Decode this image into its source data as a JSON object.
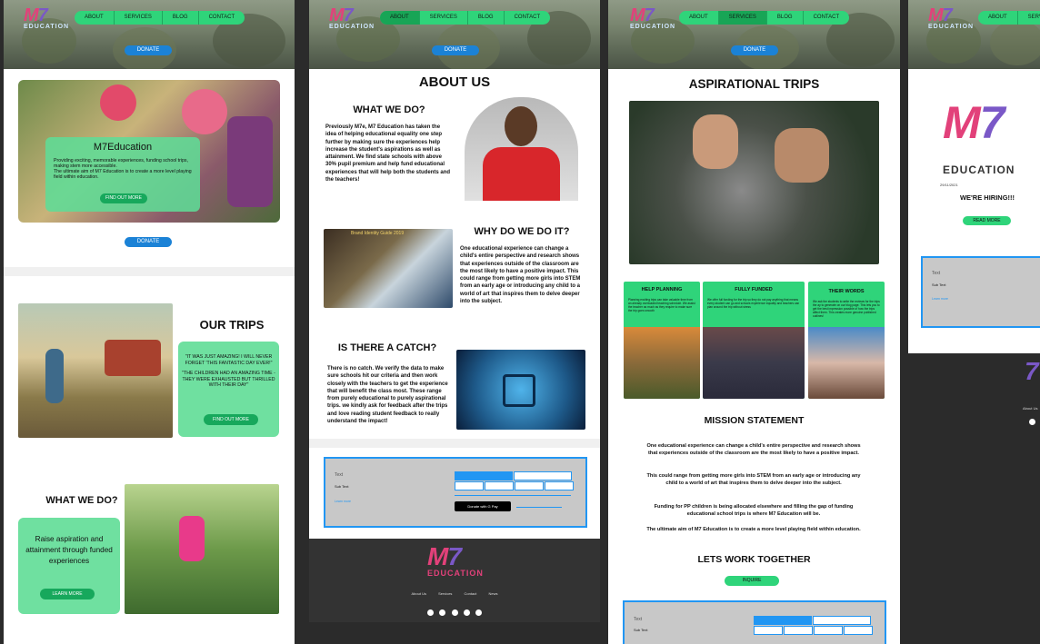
{
  "nav": {
    "about": "ABOUT",
    "services": "SERVICES",
    "blog": "BLOG",
    "contact": "CONTACT"
  },
  "donate_label": "DONATE",
  "logo": {
    "text": "M7",
    "sub": "EDUCATION"
  },
  "home": {
    "card_title": "M7Education",
    "card_body": "Providing exciting, memorable experiences, funding school trips, making stem more accessible.",
    "card_body2": "The ultimate aim of M7 Education is to create a more level playing field within education.",
    "find_out": "FIND OUT MORE",
    "trips_title": "OUR TRIPS",
    "quote1": "\"IT WAS JUST AMAZING! I WILL NEVER FORGET 'THIS FANTASTIC DAY EVER!\"",
    "quote2": "\"THE CHILDREN HAD AN AMAZING TIME - THEY WERE EXHAUSTED BUT THRILLED WITH THEIR DAY\"",
    "whatwedo_title": "WHAT WE DO?",
    "whatwedo_body": "Raise aspiration and attainment through funded experiences",
    "learn_more": "LEARN MORE"
  },
  "about": {
    "title": "ABOUT US",
    "q1": "WHAT WE DO?",
    "p1": "Previously M7e, M7 Education has taken the idea of helping educational equality one step further by making sure the experiences help increase the student's aspirations as well as attainment. We find state schools with above 30% pupil premium and help fund educational experiences that will help both the students and the teachers!",
    "q2": "WHY DO WE DO IT?",
    "p2": "One educational experience can change a child's entire perspective and research shows that experiences outside of the classroom are the most likely to have a positive impact. This could range from getting more girls into STEM from an early age or introducing any child to a world of art that inspires them to delve deeper into the subject.",
    "q3": "IS THERE A CATCH?",
    "p3": "There is no catch. We verify the data to make sure schools hit our criteria and then work closely with the teachers to get the experience that will benefit the class most. These range from purely educational to purely aspirational trips. we kindly ask for feedback after the trips and love reading student feedback to really understand the impact!",
    "map_caption": "Brand Identity Guide 2019",
    "box_title": "Text",
    "box_sub": "Sub Text",
    "box_link": "Learn more",
    "gpay": "Donate with G Pay",
    "footer_links": [
      "About Us",
      "Services",
      "Contact",
      "News"
    ]
  },
  "services": {
    "title": "ASPIRATIONAL TRIPS",
    "cards": [
      {
        "title": "HELP PLANNING",
        "body": "Planning exciting trips can take valuable time from an already overloaded teaching schedule. We assist the teacher as much as they require to make sure the trip goes smooth"
      },
      {
        "title": "FULLY FUNDED",
        "body": "We offer full funding for the trip so they do not pay anything that means every student can go and schools experience equality and teachers can plan around the trip without stress"
      },
      {
        "title": "THEIR WORDS",
        "body": "We ask the students to write the reviews for the trips the ay to generate on our blog page. This lets you to get the best impression possible of how the trips affect them. This creates more genuine published outlines!"
      }
    ],
    "mission_title": "MISSION STATEMENT",
    "m1": "One educational experience can change a child's entire perspective and research shows that experiences outside of the classroom are the most likely to have a positive impact.",
    "m2": "This could range from getting more girls into STEM from an early age or introducing any child to a world of art that inspires them to delve deeper into the subject.",
    "m3": "Funding for PP children is being allocated elsewhere and filling the gap of funding educational school trips is where M7 Education will be.",
    "m4": "The ultimate aim of M7 Education is to create a more level playing field within education.",
    "together": "LETS WORK TOGETHER",
    "inquire": "INQUIRE"
  },
  "blog": {
    "date": "29/11/2021",
    "headline": "WE'RE HIRING!!!",
    "read_more": "READ MORE",
    "box_title": "Text",
    "box_sub": "Sub Text",
    "box_link": "Learn more",
    "footer_text": "About Us"
  }
}
